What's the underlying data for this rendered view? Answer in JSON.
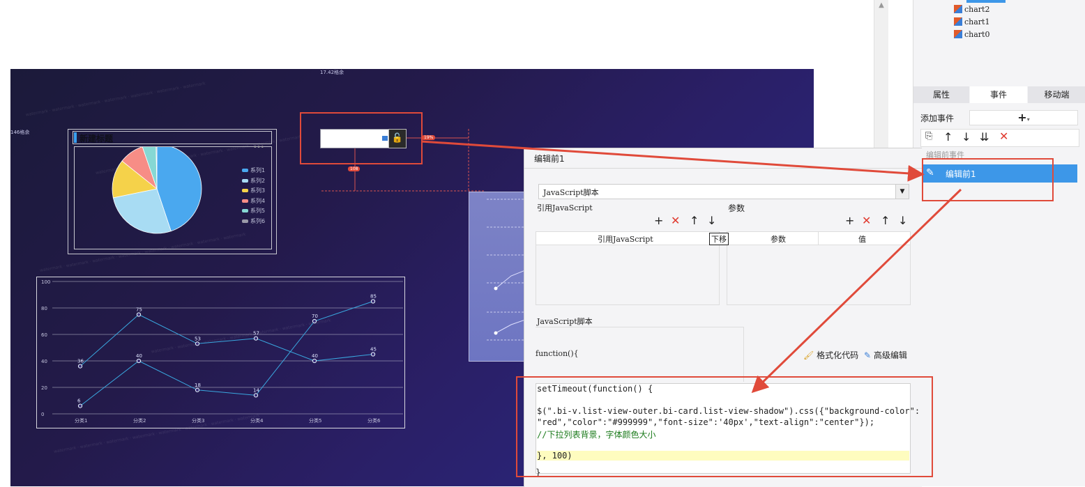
{
  "tree": {
    "items": [
      "chart2",
      "chart1",
      "chart0"
    ]
  },
  "right_tabs": [
    "属性",
    "事件",
    "移动端"
  ],
  "events": {
    "add_label": "添加事件",
    "add_button": "+",
    "group_label": "编辑前事件",
    "selected_event": "编辑前1"
  },
  "dialog": {
    "title": "编辑前1",
    "type_select": "JavaScript脚本",
    "ref_js_label": "引用JavaScript",
    "params_label": "参数",
    "ref_table_header": "引用JavaScript",
    "params_headers": [
      "参数",
      "值"
    ],
    "tooltip": "下移",
    "script_label": "JavaScript脚本",
    "function_open": "function(){",
    "format_code": "格式化代码",
    "advanced_edit": "高级编辑",
    "closing_brace": "}",
    "code": {
      "line1": "setTimeout(function() {",
      "line2": "$(\".bi-v.list-view-outer.bi-card.list-view-shadow\").css({\"background-color\":",
      "line3": "\"red\",\"color\":\"#999999\",\"font-size\":'40px',\"text-align\":\"center\"});",
      "line4": "//下拉列表背景，字体颜色大小",
      "line5": "}, 100)"
    }
  },
  "canvas": {
    "top_label": "17.42格余",
    "left_label": "146格余",
    "pie_title": "新建标题",
    "badge_right": "19%",
    "badge_down": "108"
  },
  "colors": {
    "accent": "#3aa0f0",
    "red_highlight": "#e04a3a",
    "selected_event_bg": "#3d97e8"
  },
  "chart_data": [
    {
      "type": "pie",
      "title": "新建标题",
      "categories": [
        "系列1",
        "系列2",
        "系列3",
        "系列4",
        "系列5",
        "系列6"
      ],
      "values": [
        45,
        27,
        14,
        9,
        5,
        0.3
      ],
      "colors": [
        "#4aa8ef",
        "#a8dcf3",
        "#f5d24a",
        "#f78d86",
        "#86d8d4",
        "#9a9aa8"
      ],
      "legend": "right"
    },
    {
      "type": "line",
      "categories": [
        "分类1",
        "分类2",
        "分类3",
        "分类4",
        "分类5",
        "分类6"
      ],
      "series": [
        {
          "values": [
            36,
            75,
            53,
            57,
            40,
            45
          ]
        },
        {
          "values": [
            6,
            40,
            18,
            14,
            70,
            85
          ]
        }
      ],
      "data_labels": [
        [
          "36",
          "75",
          "53",
          "57",
          "40",
          "45"
        ],
        [
          "6",
          "40",
          "18",
          "14",
          "70",
          "85"
        ]
      ],
      "yticks": [
        "0",
        "20",
        "40",
        "60",
        "80",
        "100"
      ],
      "ylim": [
        0,
        100
      ],
      "grid": true
    }
  ]
}
